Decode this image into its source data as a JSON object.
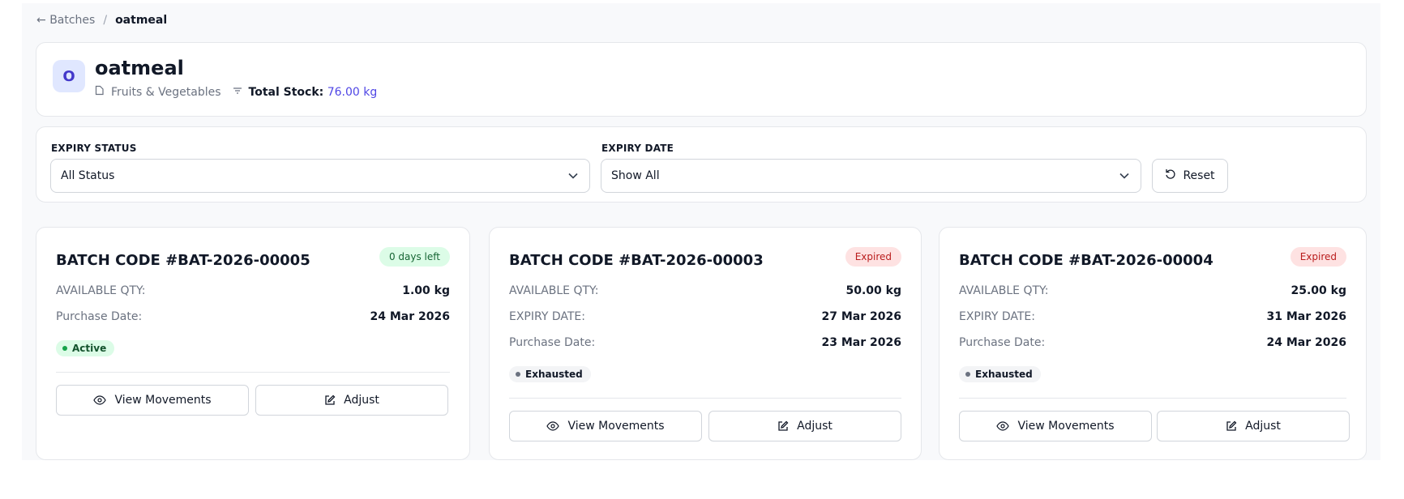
{
  "breadcrumb": {
    "back_label": "Batches",
    "separator": "/",
    "current": "oatmeal"
  },
  "product": {
    "initial": "O",
    "name": "oatmeal",
    "category": "Fruits & Vegetables",
    "total_stock_label": "Total Stock:",
    "total_stock_value": "76.00 kg"
  },
  "filters": {
    "expiry_status": {
      "label": "EXPIRY STATUS",
      "selected": "All Status"
    },
    "expiry_date": {
      "label": "EXPIRY DATE",
      "selected": "Show All"
    },
    "reset_label": "Reset"
  },
  "labels": {
    "available_qty": "AVAILABLE QTY:",
    "expiry_date": "EXPIRY DATE:",
    "purchase_date": "Purchase Date:",
    "view_movements": "View Movements",
    "adjust": "Adjust"
  },
  "batches": [
    {
      "title": "BATCH CODE #BAT-2026-00005",
      "badge": "0 days left",
      "available_qty": "1.00 kg",
      "purchase_date": "24 Mar 2026",
      "status": "Active"
    },
    {
      "title": "BATCH CODE #BAT-2026-00003",
      "badge": "Expired",
      "available_qty": "50.00 kg",
      "expiry_date": "27 Mar 2026",
      "purchase_date": "23 Mar 2026",
      "status": "Exhausted"
    },
    {
      "title": "BATCH CODE #BAT-2026-00004",
      "badge": "Expired",
      "available_qty": "25.00 kg",
      "expiry_date": "31 Mar 2026",
      "purchase_date": "24 Mar 2026",
      "status": "Exhausted"
    }
  ],
  "colors": {
    "accent": "#4f46e5",
    "active": "#16a34a",
    "expired": "#b91c1c",
    "border": "#e5e7eb"
  }
}
